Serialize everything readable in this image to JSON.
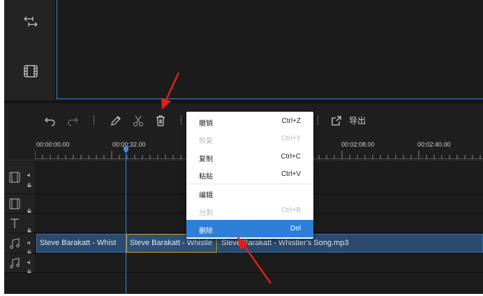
{
  "toolbar": {
    "export_label": "导出"
  },
  "ruler": {
    "labels": [
      "00:00:00.00",
      "00:00:32.00",
      "00:02:08.00",
      "00:02:40.00"
    ]
  },
  "tracks": {
    "clips": [
      "Steve Barakatt - Whist",
      "Steve Barakatt - Whistle",
      "Steve Barakatt - Whistler's Song.mp3"
    ]
  },
  "context_menu": {
    "items": [
      {
        "label": "撤销",
        "shortcut": "Ctrl+Z",
        "enabled": true
      },
      {
        "label": "恢复",
        "shortcut": "Ctrl+Y",
        "enabled": false
      },
      {
        "label": "复制",
        "shortcut": "Ctrl+C",
        "enabled": true
      },
      {
        "label": "粘贴",
        "shortcut": "Ctrl+V",
        "enabled": true
      },
      {
        "label": "编辑",
        "shortcut": "",
        "enabled": true
      },
      {
        "label": "分割",
        "shortcut": "Ctrl+B",
        "enabled": false
      },
      {
        "label": "删除",
        "shortcut": "Del",
        "enabled": true,
        "highlighted": true
      }
    ]
  },
  "colors": {
    "accent": "#2d7fd8",
    "playhead": "#3a8de0",
    "annotation": "#e0201a",
    "clip": "#2b4a6e"
  },
  "icons": [
    "split-arrows-icon",
    "film-icon",
    "undo-icon",
    "redo-icon",
    "pencil-icon",
    "scissors-icon",
    "trash-icon",
    "export-icon",
    "video-track-icon",
    "image-track-icon",
    "text-track-icon",
    "music-track-icon",
    "speaker-icon",
    "lock-icon"
  ]
}
